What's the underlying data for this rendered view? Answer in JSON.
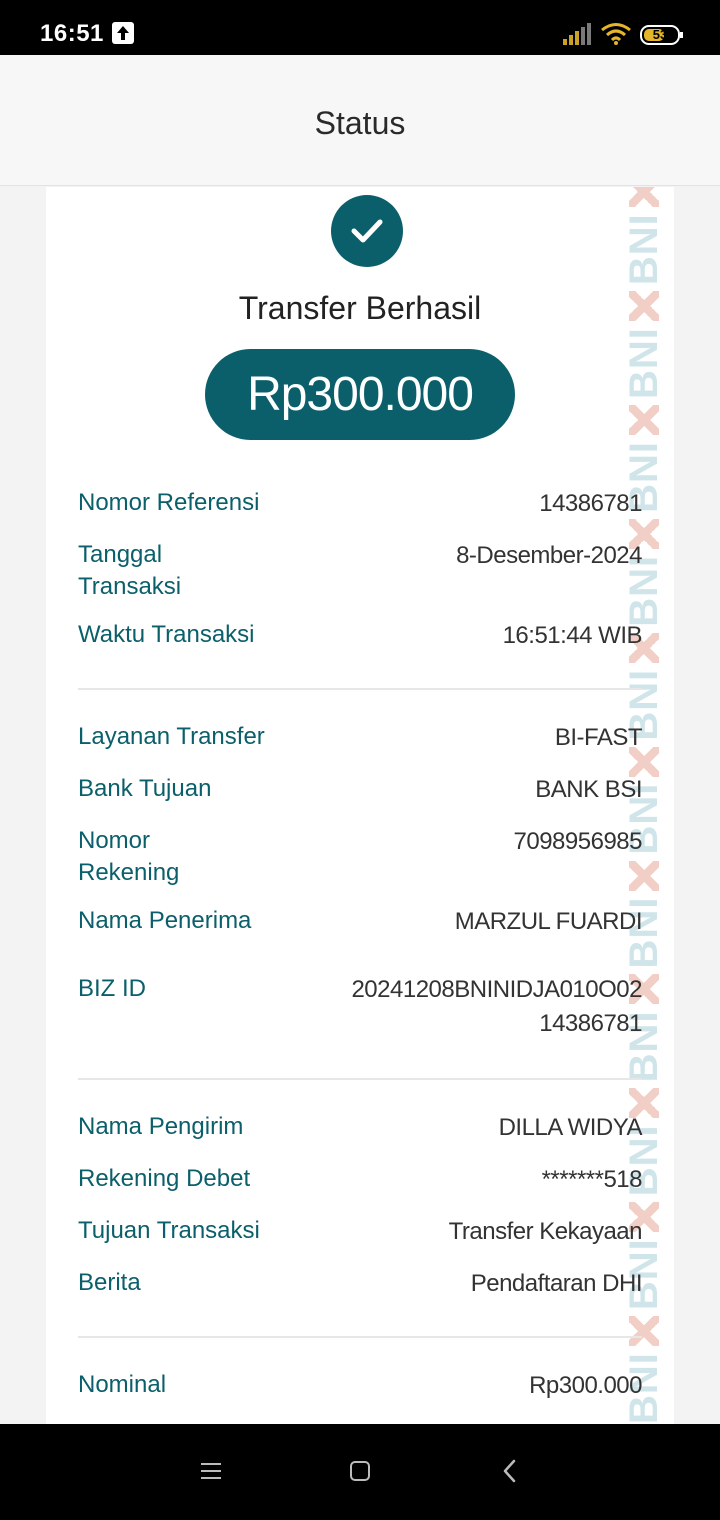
{
  "status_bar": {
    "time": "16:51",
    "battery_level": "53",
    "icons": [
      "upload-icon",
      "signal-icon",
      "wifi-icon",
      "battery-icon"
    ]
  },
  "header": {
    "title": "Status"
  },
  "receipt": {
    "success_title": "Transfer Berhasil",
    "amount": "Rp300.000",
    "watermark_text": "BNI",
    "sections": [
      {
        "rows": [
          {
            "label": "Nomor Referensi",
            "value": "14386781"
          },
          {
            "label": "Tanggal Transaksi",
            "value": "8-Desember-2024"
          },
          {
            "label": "Waktu Transaksi",
            "value": "16:51:44 WIB"
          }
        ]
      },
      {
        "rows": [
          {
            "label": "Layanan Transfer",
            "value": "BI-FAST"
          },
          {
            "label": "Bank Tujuan",
            "value": "BANK BSI"
          },
          {
            "label": "Nomor Rekening",
            "value": "7098956985"
          },
          {
            "label": "Nama Penerima",
            "value": "MARZUL FUARDI"
          },
          {
            "label": "BIZ ID",
            "value": "20241208BNINIDJA010O0214386781"
          }
        ]
      },
      {
        "rows": [
          {
            "label": "Nama Pengirim",
            "value": "DILLA WIDYA"
          },
          {
            "label": "Rekening Debet",
            "value": "*******518"
          },
          {
            "label": "Tujuan Transaksi",
            "value": "Transfer Kekayaan"
          },
          {
            "label": "Berita",
            "value": "Pendaftaran DHI"
          }
        ]
      },
      {
        "rows": [
          {
            "label": "Nominal",
            "value": "Rp300.000"
          }
        ]
      }
    ]
  },
  "nav_bar": {
    "icons": [
      "menu-icon",
      "home-icon",
      "back-icon"
    ]
  },
  "colors": {
    "primary": "#0b5f6b",
    "label": "#0b5f6b",
    "value": "#333333",
    "watermark": "#cfe5ea",
    "watermark_mark": "#f1cfc6"
  }
}
